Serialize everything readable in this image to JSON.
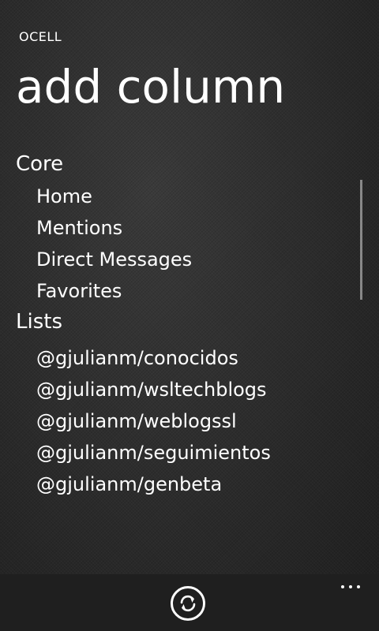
{
  "app": {
    "name": "OCELL"
  },
  "page": {
    "title": "add column"
  },
  "groups": [
    {
      "header": "Core",
      "items": [
        {
          "label": "Home"
        },
        {
          "label": "Mentions"
        },
        {
          "label": "Direct Messages"
        },
        {
          "label": "Favorites"
        }
      ]
    },
    {
      "header": "Lists",
      "items": [
        {
          "label": "@gjulianm/conocidos"
        },
        {
          "label": "@gjulianm/wsltechblogs"
        },
        {
          "label": "@gjulianm/weblogssl"
        },
        {
          "label": "@gjulianm/seguimientos"
        },
        {
          "label": "@gjulianm/genbeta"
        }
      ]
    }
  ],
  "appbar": {
    "buttons": [
      {
        "icon": "refresh-icon"
      },
      {
        "icon": "more-icon"
      }
    ]
  },
  "colors": {
    "text": "#ffffff",
    "appbar_background": "#1f1f1f",
    "background": "#2a2a2a"
  }
}
